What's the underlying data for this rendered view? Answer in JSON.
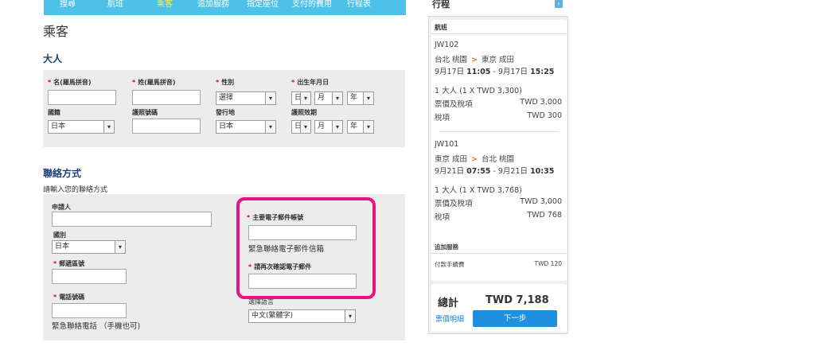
{
  "nav": {
    "items": [
      {
        "label": "搜尋"
      },
      {
        "label": "航班"
      },
      {
        "label": "乘客"
      },
      {
        "label": "追加服務"
      },
      {
        "label": "指定座位"
      },
      {
        "label": "支付的費用"
      },
      {
        "label": "行程表"
      }
    ]
  },
  "page_title": "乘客",
  "adult": {
    "section_title": "大人",
    "first_name_label": "名(羅馬拼音)",
    "last_name_label": "姓(羅馬拼音)",
    "gender_label": "性別",
    "gender_value": "選擇",
    "dob_label": "出生年月日",
    "dob_day": "日",
    "dob_month": "月",
    "dob_year": "年",
    "nationality_label": "國籍",
    "nationality_value": "日本",
    "passport_number_label": "護照號碼",
    "issuing_country_label": "發行地",
    "issuing_country_value": "日本",
    "passport_expiry_label": "護照效期",
    "expiry_day": "日",
    "expiry_month": "月",
    "expiry_year": "年"
  },
  "contact": {
    "section_title": "聯絡方式",
    "note": "請輸入您的聯絡方式",
    "applicant_label": "申請人",
    "country_label": "國別",
    "country_value": "日本",
    "postal_code_label": "郵遞區號",
    "phone_label": "電話號碼",
    "phone_hint": "緊急聯絡電話 （手機也可)",
    "email_label": "主要電子郵件帳號",
    "email_hint": "緊急聯絡電子郵件信箱",
    "email_confirm_label": "請再次確認電子郵件",
    "language_label": "選擇語言",
    "language_value": "中文(繁體字)"
  },
  "itinerary": {
    "title": "行程",
    "toggle": "›",
    "flights_header": "航班",
    "outbound": {
      "flight_no": "JW102",
      "from": "台北 桃園",
      "arrow": ">",
      "to": "東京 成田",
      "dep_date": "9月17日",
      "dep_time": "11:05",
      "sep": " - ",
      "arr_date": "9月17日",
      "arr_time": "15:25",
      "pax_line": "1 大人 (1 X TWD 3,300)",
      "fare_label": "票價及稅項",
      "fare_value": "TWD 3,000",
      "tax_label": "稅項",
      "tax_value": "TWD 300"
    },
    "inbound": {
      "flight_no": "JW101",
      "from": "東京 成田",
      "arrow": ">",
      "to": "台北 桃園",
      "dep_date": "9月21日",
      "dep_time": "07:55",
      "sep": " - ",
      "arr_date": "9月21日",
      "arr_time": "10:35",
      "pax_line": "1 大人 (1 X TWD 3,768)",
      "fare_label": "票價及稅項",
      "fare_value": "TWD 3,000",
      "tax_label": "稅項",
      "tax_value": "TWD 768"
    },
    "extras_header": "追加服務",
    "extras_item_label": "付款手續費",
    "extras_item_value": "TWD 120",
    "total_label": "總計",
    "total_value": "TWD 7,188",
    "fare_details_link": "票價明細",
    "next_button": "下一步"
  },
  "colors": {
    "nav_bg": "#4ec1e8",
    "nav_active": "#ffef3c",
    "section_title": "#1c3f7a",
    "required_star": "#d0021b",
    "highlight_border": "#e5157d",
    "primary_button": "#1f8fe0",
    "link": "#1a7fc8",
    "route_arrow": "#e07a1f"
  }
}
